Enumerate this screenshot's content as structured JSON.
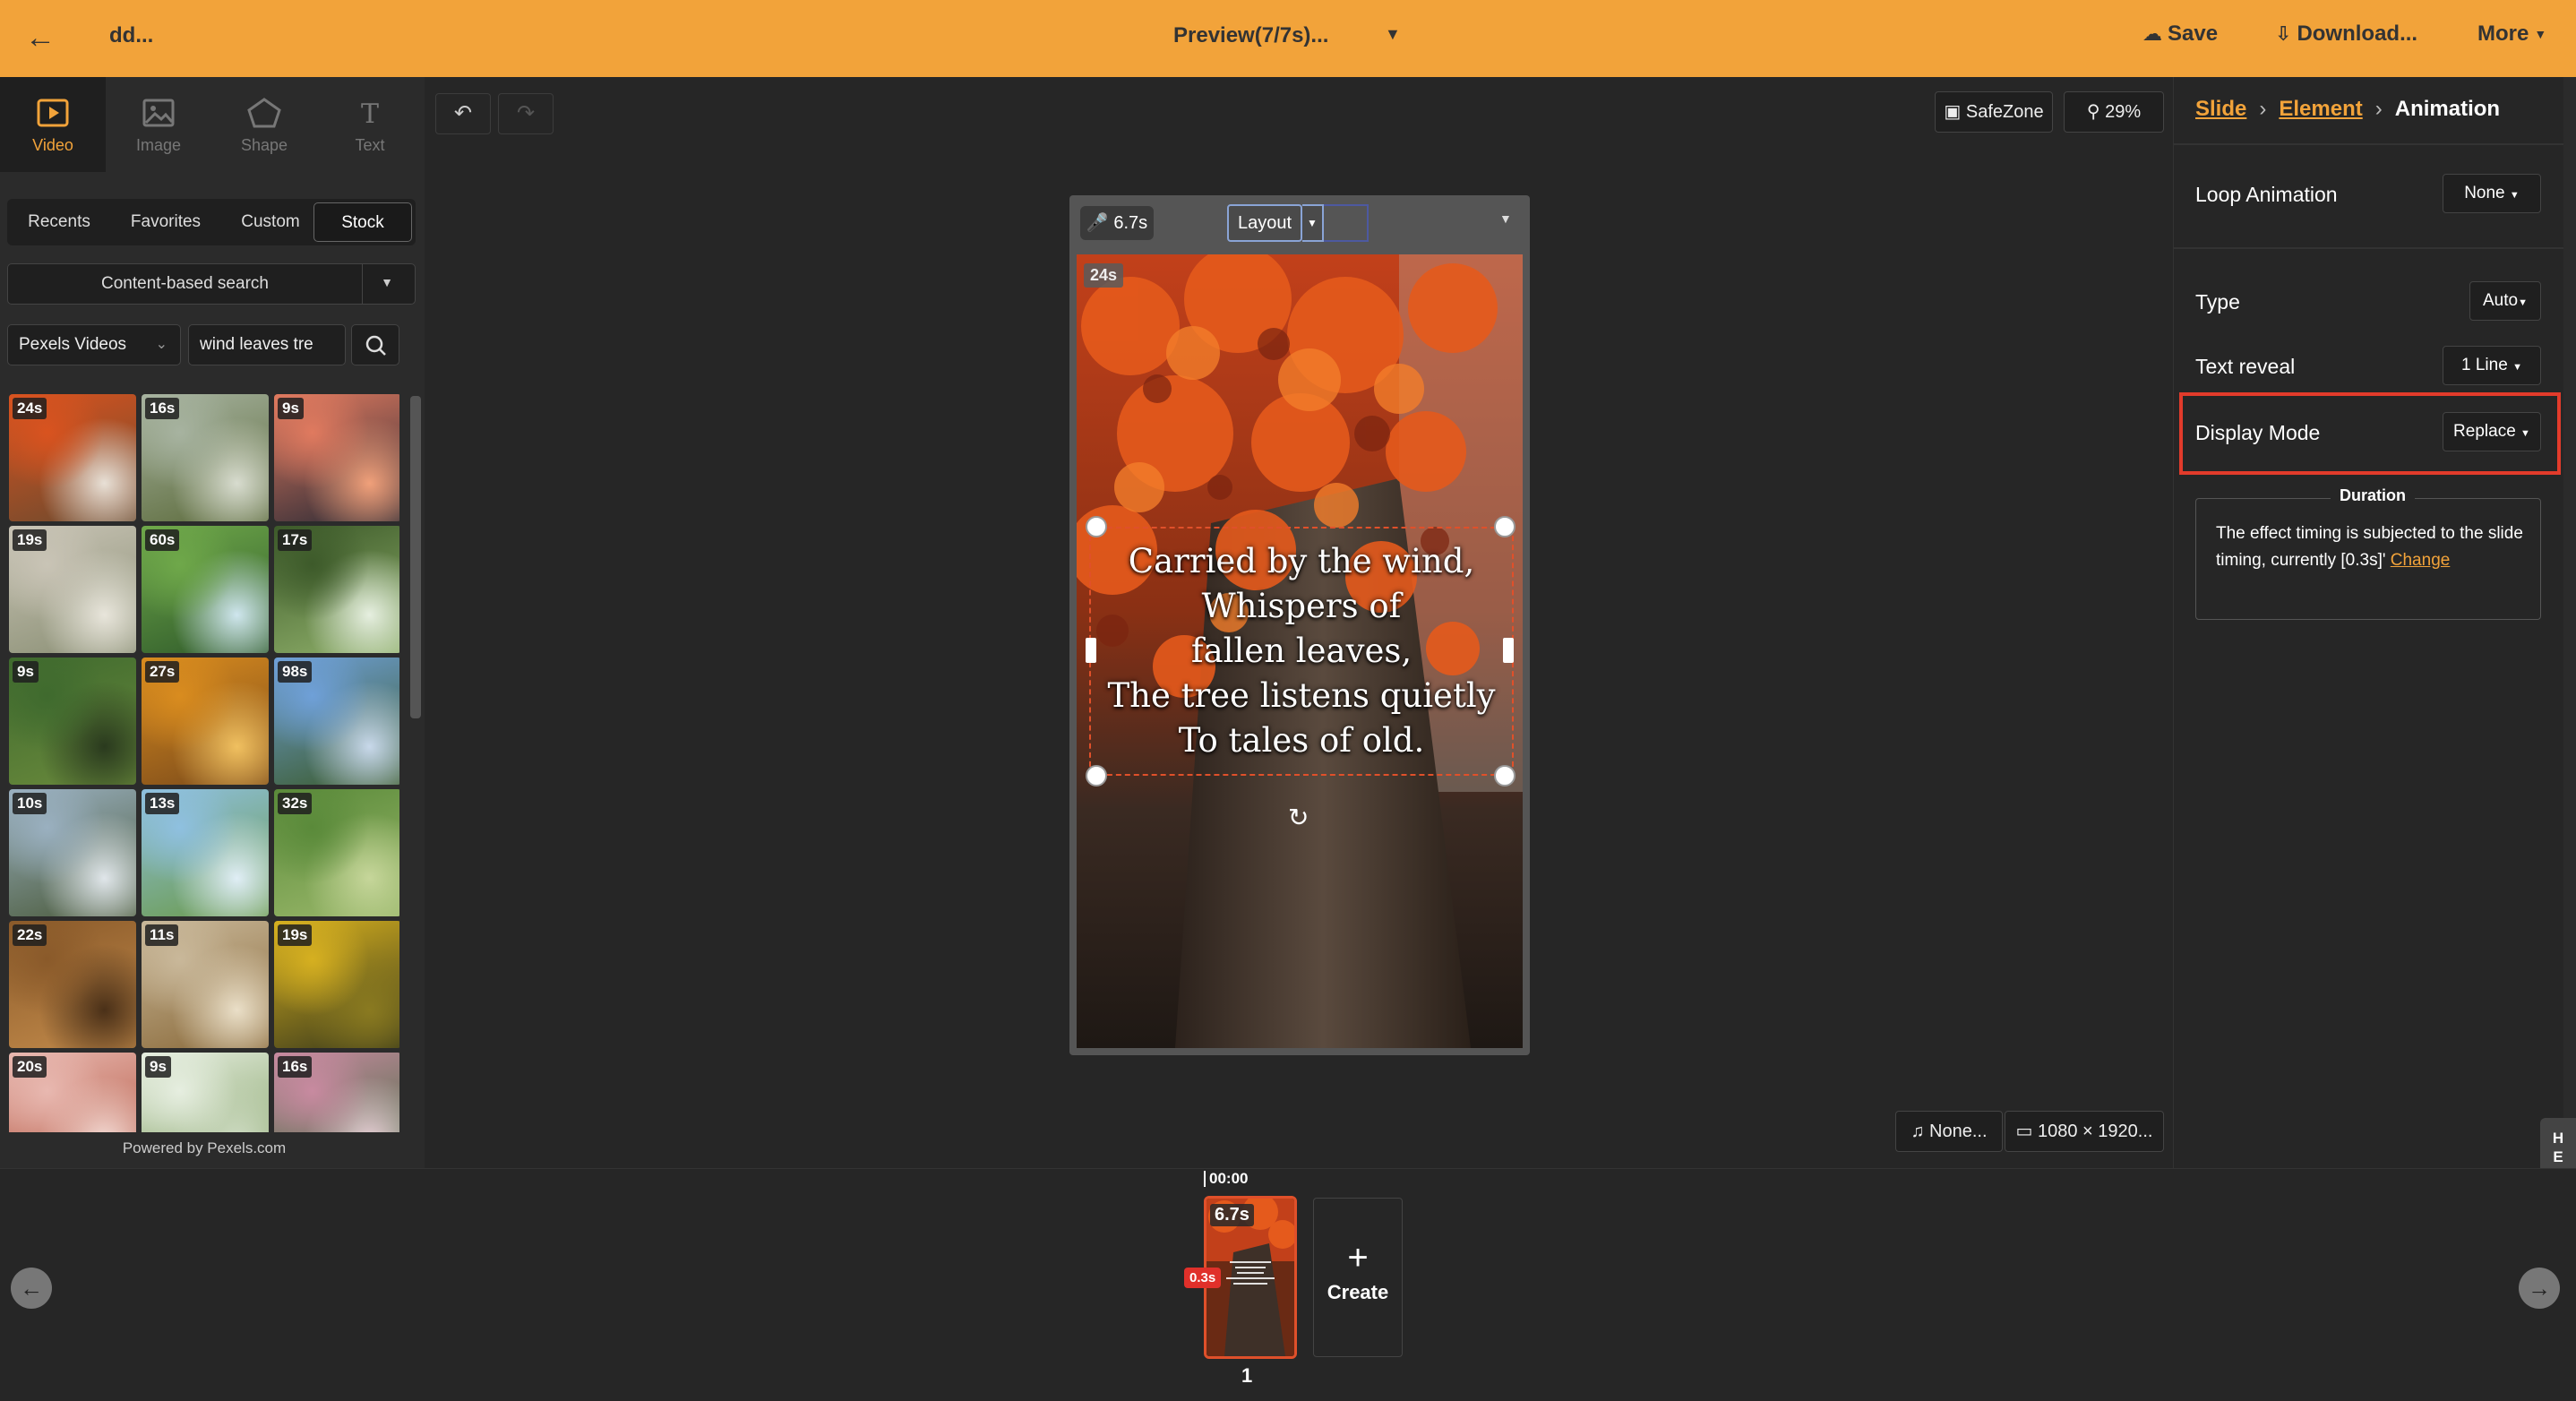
{
  "topbar": {
    "project_title": "dd...",
    "preview_label": "Preview(7/7s)...",
    "save_label": "Save",
    "download_label": "Download...",
    "more_label": "More"
  },
  "left_panel": {
    "tool_tabs": [
      {
        "label": "Video",
        "icon": "video-icon",
        "active": true
      },
      {
        "label": "Image",
        "icon": "image-icon",
        "active": false
      },
      {
        "label": "Shape",
        "icon": "pentagon-icon",
        "active": false
      },
      {
        "label": "Text",
        "icon": "text-icon",
        "active": false
      }
    ],
    "source_tabs": [
      {
        "label": "Recents",
        "active": false
      },
      {
        "label": "Favorites",
        "active": false
      },
      {
        "label": "Custom",
        "active": false
      },
      {
        "label": "Stock",
        "active": true
      }
    ],
    "search_mode": "Content-based search",
    "provider": "Pexels Videos",
    "query": "wind leaves tre",
    "thumbnails": [
      {
        "duration": "24s"
      },
      {
        "duration": "16s"
      },
      {
        "duration": "9s"
      },
      {
        "duration": "19s"
      },
      {
        "duration": "60s"
      },
      {
        "duration": "17s"
      },
      {
        "duration": "9s"
      },
      {
        "duration": "27s"
      },
      {
        "duration": "98s"
      },
      {
        "duration": "10s"
      },
      {
        "duration": "13s"
      },
      {
        "duration": "32s"
      },
      {
        "duration": "22s"
      },
      {
        "duration": "11s"
      },
      {
        "duration": "19s"
      },
      {
        "duration": "20s"
      },
      {
        "duration": "9s"
      },
      {
        "duration": "16s"
      }
    ],
    "powered_by": "Powered by Pexels.com"
  },
  "canvas": {
    "safezone_label": "SafeZone",
    "zoom_label": "29%",
    "voice_duration": "6.7s",
    "layout_label": "Layout",
    "slide_badge": "24s",
    "caption_lines": [
      "Carried by the wind,",
      "Whispers of",
      "fallen leaves,",
      "The tree listens quietly",
      "To tales of old."
    ],
    "music_label": "None...",
    "resolution_label": "1080 × 1920..."
  },
  "right_panel": {
    "breadcrumb": {
      "slide": "Slide",
      "element": "Element",
      "current": "Animation"
    },
    "loop_animation": {
      "label": "Loop Animation",
      "value": "None"
    },
    "type": {
      "label": "Type",
      "value": "Auto"
    },
    "text_reveal": {
      "label": "Text reveal",
      "value": "1 Line"
    },
    "display_mode": {
      "label": "Display Mode",
      "value": "Replace"
    },
    "duration": {
      "title": "Duration",
      "text": "The effect timing is subjected to the slide timing, currently [0.3s]'",
      "change_label": "Change"
    },
    "help_label": "HELP"
  },
  "timeline": {
    "time_marker": "00:00",
    "clip_duration": "6.7s",
    "transition": "0.3s",
    "clip_number": "1",
    "create_label": "Create"
  },
  "colors": {
    "accent": "#f2a33a",
    "highlight_red": "#e23b2b",
    "panel_bg": "#262626"
  }
}
